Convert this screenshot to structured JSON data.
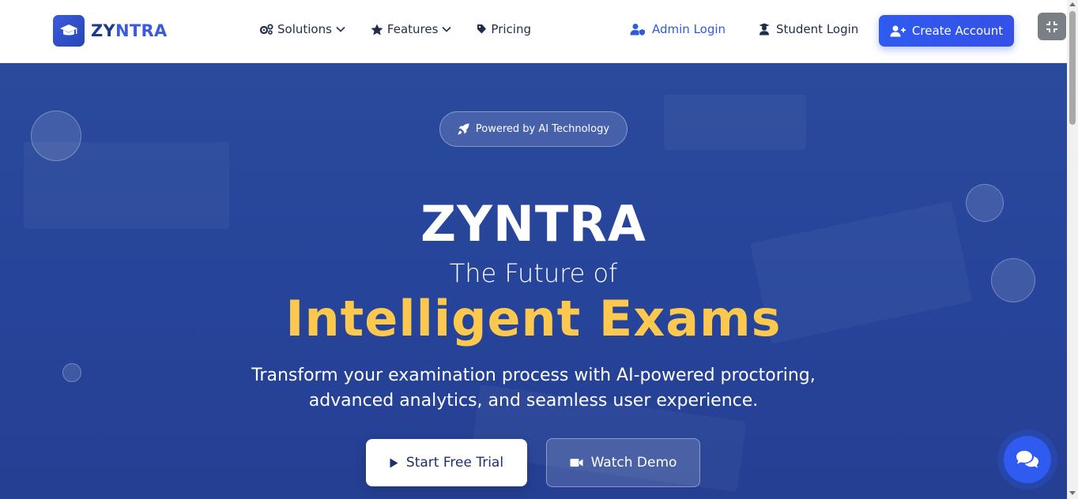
{
  "brand": {
    "name_head": "ZY",
    "name_tail": "NTRA",
    "icon": "graduation-cap-icon"
  },
  "nav": {
    "links": [
      {
        "label": "Solutions",
        "icon": "cogs-icon",
        "dropdown": true
      },
      {
        "label": "Features",
        "icon": "star-icon",
        "dropdown": true
      },
      {
        "label": "Pricing",
        "icon": "tag-icon",
        "dropdown": false
      }
    ],
    "admin_login": "Admin Login",
    "student_login": "Student Login",
    "create_account": "Create Account"
  },
  "hero": {
    "badge": "Powered by AI Technology",
    "brand": "ZYNTRA",
    "subtitle": "The Future of",
    "highlight": "Intelligent Exams",
    "description_line1": "Transform your examination process with AI-powered proctoring,",
    "description_line2": "advanced analytics, and seamless user experience.",
    "primary_cta": "Start Free Trial",
    "secondary_cta": "Watch Demo"
  },
  "colors": {
    "accent": "#2f5bf0",
    "hero_bg": "#26449a",
    "highlight": "#fcc94e"
  }
}
